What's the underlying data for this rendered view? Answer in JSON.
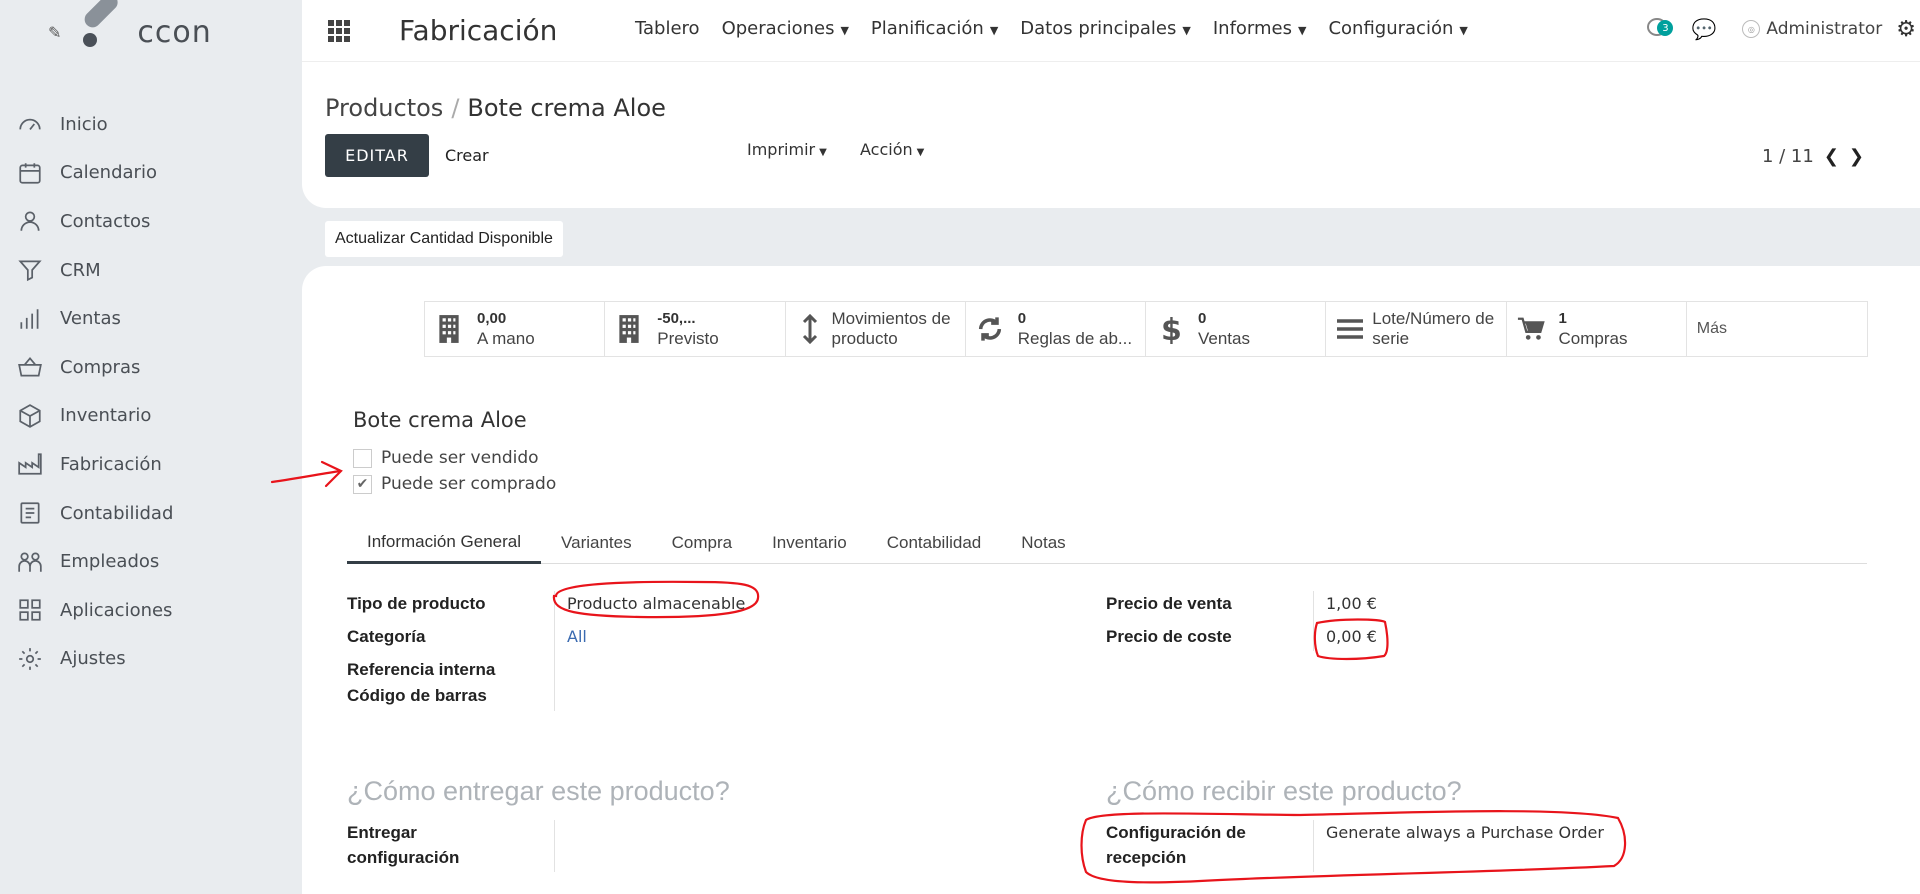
{
  "brand": {
    "logo_text": "ccon"
  },
  "sidebar": {
    "items": [
      {
        "label": "Inicio",
        "icon": "gauge-icon"
      },
      {
        "label": "Calendario",
        "icon": "calendar-icon"
      },
      {
        "label": "Contactos",
        "icon": "user-icon"
      },
      {
        "label": "CRM",
        "icon": "funnel-icon"
      },
      {
        "label": "Ventas",
        "icon": "bar-chart-icon"
      },
      {
        "label": "Compras",
        "icon": "basket-icon"
      },
      {
        "label": "Inventario",
        "icon": "box-icon"
      },
      {
        "label": "Fabricación",
        "icon": "factory-icon"
      },
      {
        "label": "Contabilidad",
        "icon": "ledger-icon"
      },
      {
        "label": "Empleados",
        "icon": "people-icon"
      },
      {
        "label": "Aplicaciones",
        "icon": "grid-icon"
      },
      {
        "label": "Ajustes",
        "icon": "gear-icon"
      }
    ]
  },
  "topbar": {
    "app_title": "Fabricación",
    "nav": [
      {
        "label": "Tablero",
        "dropdown": false
      },
      {
        "label": "Operaciones",
        "dropdown": true
      },
      {
        "label": "Planificación",
        "dropdown": true
      },
      {
        "label": "Datos principales",
        "dropdown": true
      },
      {
        "label": "Informes",
        "dropdown": true
      },
      {
        "label": "Configuración",
        "dropdown": true
      }
    ],
    "notification_count": "3",
    "user_name": "Administrator"
  },
  "control": {
    "breadcrumb_parent": "Productos",
    "breadcrumb_current": "Bote crema Aloe",
    "edit_label": "EDITAR",
    "create_label": "Crear",
    "print_label": "Imprimir",
    "action_label": "Acción",
    "pager": "1 / 11"
  },
  "update_qty_label": "Actualizar Cantidad Disponible",
  "stats": [
    {
      "value": "0,00",
      "label": "A mano",
      "icon": "building-icon"
    },
    {
      "value": "-50,...",
      "label": "Previsto",
      "icon": "building-icon"
    },
    {
      "value": "",
      "label": "Movimientos de producto",
      "icon": "arrows-vertical-icon"
    },
    {
      "value": "0",
      "label": "Reglas de ab...",
      "icon": "refresh-icon"
    },
    {
      "value": "0",
      "label": "Ventas",
      "icon": "dollar-icon"
    },
    {
      "value": "",
      "label": "Lote/Número de serie",
      "icon": "bars-icon"
    },
    {
      "value": "1",
      "label": "Compras",
      "icon": "cart-icon"
    },
    {
      "value": "",
      "label": "Más",
      "icon": ""
    }
  ],
  "product": {
    "name": "Bote crema Aloe",
    "can_be_sold_label": "Puede ser vendido",
    "can_be_sold": false,
    "can_be_purchased_label": "Puede ser comprado",
    "can_be_purchased": true
  },
  "tabs": [
    "Información General",
    "Variantes",
    "Compra",
    "Inventario",
    "Contabilidad",
    "Notas"
  ],
  "general": {
    "product_type_label": "Tipo de producto",
    "product_type": "Producto almacenable",
    "category_label": "Categoría",
    "category": "All",
    "internal_ref_label": "Referencia interna",
    "barcode_label": "Código de barras",
    "sale_price_label": "Precio de venta",
    "sale_price": "1,00 €",
    "cost_price_label": "Precio de coste",
    "cost_price": "0,00 €",
    "deliver_title": "¿Cómo entregar este producto?",
    "deliver_config_label_1": "Entregar",
    "deliver_config_label_2": "configuración",
    "receive_title": "¿Cómo recibir este producto?",
    "receive_config_label_1": "Configuración de",
    "receive_config_label_2": "recepción",
    "receive_config": "Generate always a Purchase Order"
  },
  "colors": {
    "annotation": "#e8141b",
    "primary_btn": "#343e46",
    "badge": "#00a09d",
    "link": "#3a6ab0"
  }
}
